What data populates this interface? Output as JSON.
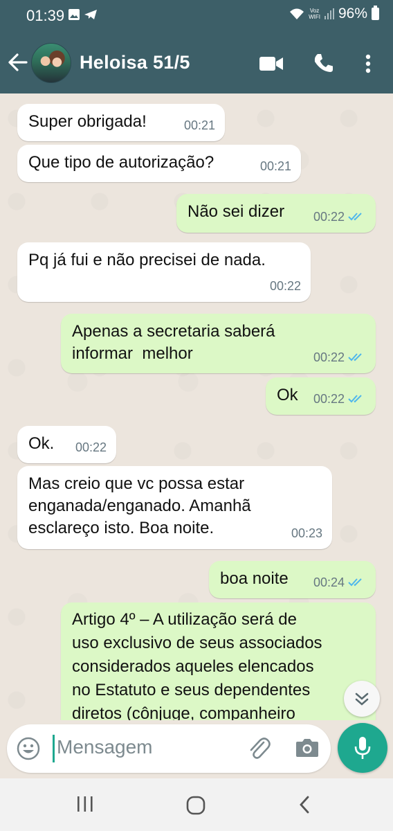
{
  "status_bar": {
    "time": "01:39",
    "voz_top": "Voz",
    "voz_bottom": "WIFI",
    "battery": "96%"
  },
  "header": {
    "contact_name": "Heloisa 51/5"
  },
  "messages": [
    {
      "direction": "in",
      "text": "Super obrigada!",
      "time": "00:21"
    },
    {
      "direction": "in",
      "text": "Que tipo de autorização?",
      "time": "00:21"
    },
    {
      "direction": "out",
      "text": "Não sei dizer",
      "time": "00:22",
      "status": "read"
    },
    {
      "direction": "in",
      "text": "Pq já fui e não precisei de nada.",
      "time": "00:22"
    },
    {
      "direction": "out",
      "text": "Apenas a secretaria saberá\ninformar  melhor",
      "time": "00:22",
      "status": "read"
    },
    {
      "direction": "out",
      "text": "Ok",
      "time": "00:22",
      "status": "read"
    },
    {
      "direction": "in",
      "text": "Ok.",
      "time": "00:22"
    },
    {
      "direction": "in",
      "text": "Mas creio que vc possa estar\nenganada/enganado. Amanhã\nesclareço isto. Boa noite.",
      "time": "00:23"
    },
    {
      "direction": "out",
      "text": "boa noite",
      "time": "00:24",
      "status": "read"
    },
    {
      "direction": "out",
      "text": "Artigo 4º – A utilização será de\nuso exclusivo de seus associados\nconsiderados aqueles elencados\nno Estatuto e seus dependentes\ndiretos (cônjuge, companheiro",
      "time": "",
      "status": ""
    }
  ],
  "composer": {
    "placeholder": "Mensagem"
  },
  "icons": {
    "back": "arrow-left-icon",
    "video": "video-camera-icon",
    "call": "phone-icon",
    "menu": "more-vertical-icon",
    "emoji": "smiley-icon",
    "attach": "paperclip-icon",
    "camera": "camera-icon",
    "mic": "microphone-icon",
    "scroll": "double-chevron-down-icon",
    "nav_recents": "recents-icon",
    "nav_home": "home-icon",
    "nav_back": "chevron-left-icon"
  },
  "colors": {
    "header": "#3d5f68",
    "incoming_bubble": "#ffffff",
    "outgoing_bubble": "#dcf8c6",
    "chat_bg": "#ece5dd",
    "accent": "#1ea88f",
    "read_tick": "#4fb6ec"
  }
}
